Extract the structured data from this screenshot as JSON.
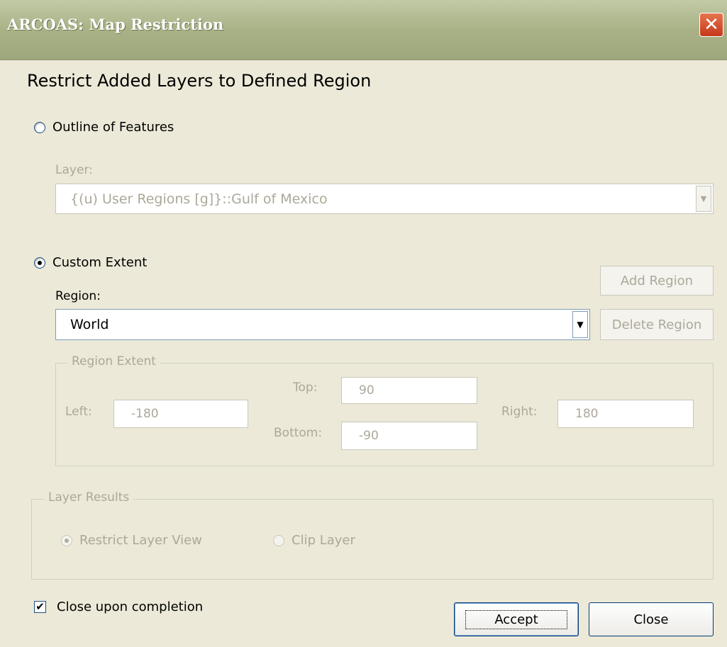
{
  "window": {
    "title": "ARCOAS:  Map Restriction",
    "close_glyph": "✕"
  },
  "heading": "Restrict Added Layers to Defined Region",
  "outline_option": {
    "label": "Outline of Features",
    "checked": false
  },
  "layer": {
    "label": "Layer:",
    "value": "{(u) User Regions [g]}::Gulf of Mexico"
  },
  "custom_option": {
    "label": "Custom Extent",
    "checked": true
  },
  "region": {
    "label": "Region:",
    "value": "World"
  },
  "buttons": {
    "add_region": "Add Region",
    "delete_region": "Delete Region",
    "accept": "Accept",
    "close": "Close"
  },
  "extent": {
    "legend": "Region Extent",
    "top_label": "Top:",
    "top": "90",
    "left_label": "Left:",
    "left": "-180",
    "right_label": "Right:",
    "right": "180",
    "bottom_label": "Bottom:",
    "bottom": "-90"
  },
  "results": {
    "legend": "Layer Results",
    "restrict_label": "Restrict Layer View",
    "clip_label": "Clip Layer"
  },
  "close_upon_completion": {
    "label": "Close upon completion",
    "checked": true,
    "glyph": "✔"
  },
  "icons": {
    "dropdown": "▼"
  }
}
